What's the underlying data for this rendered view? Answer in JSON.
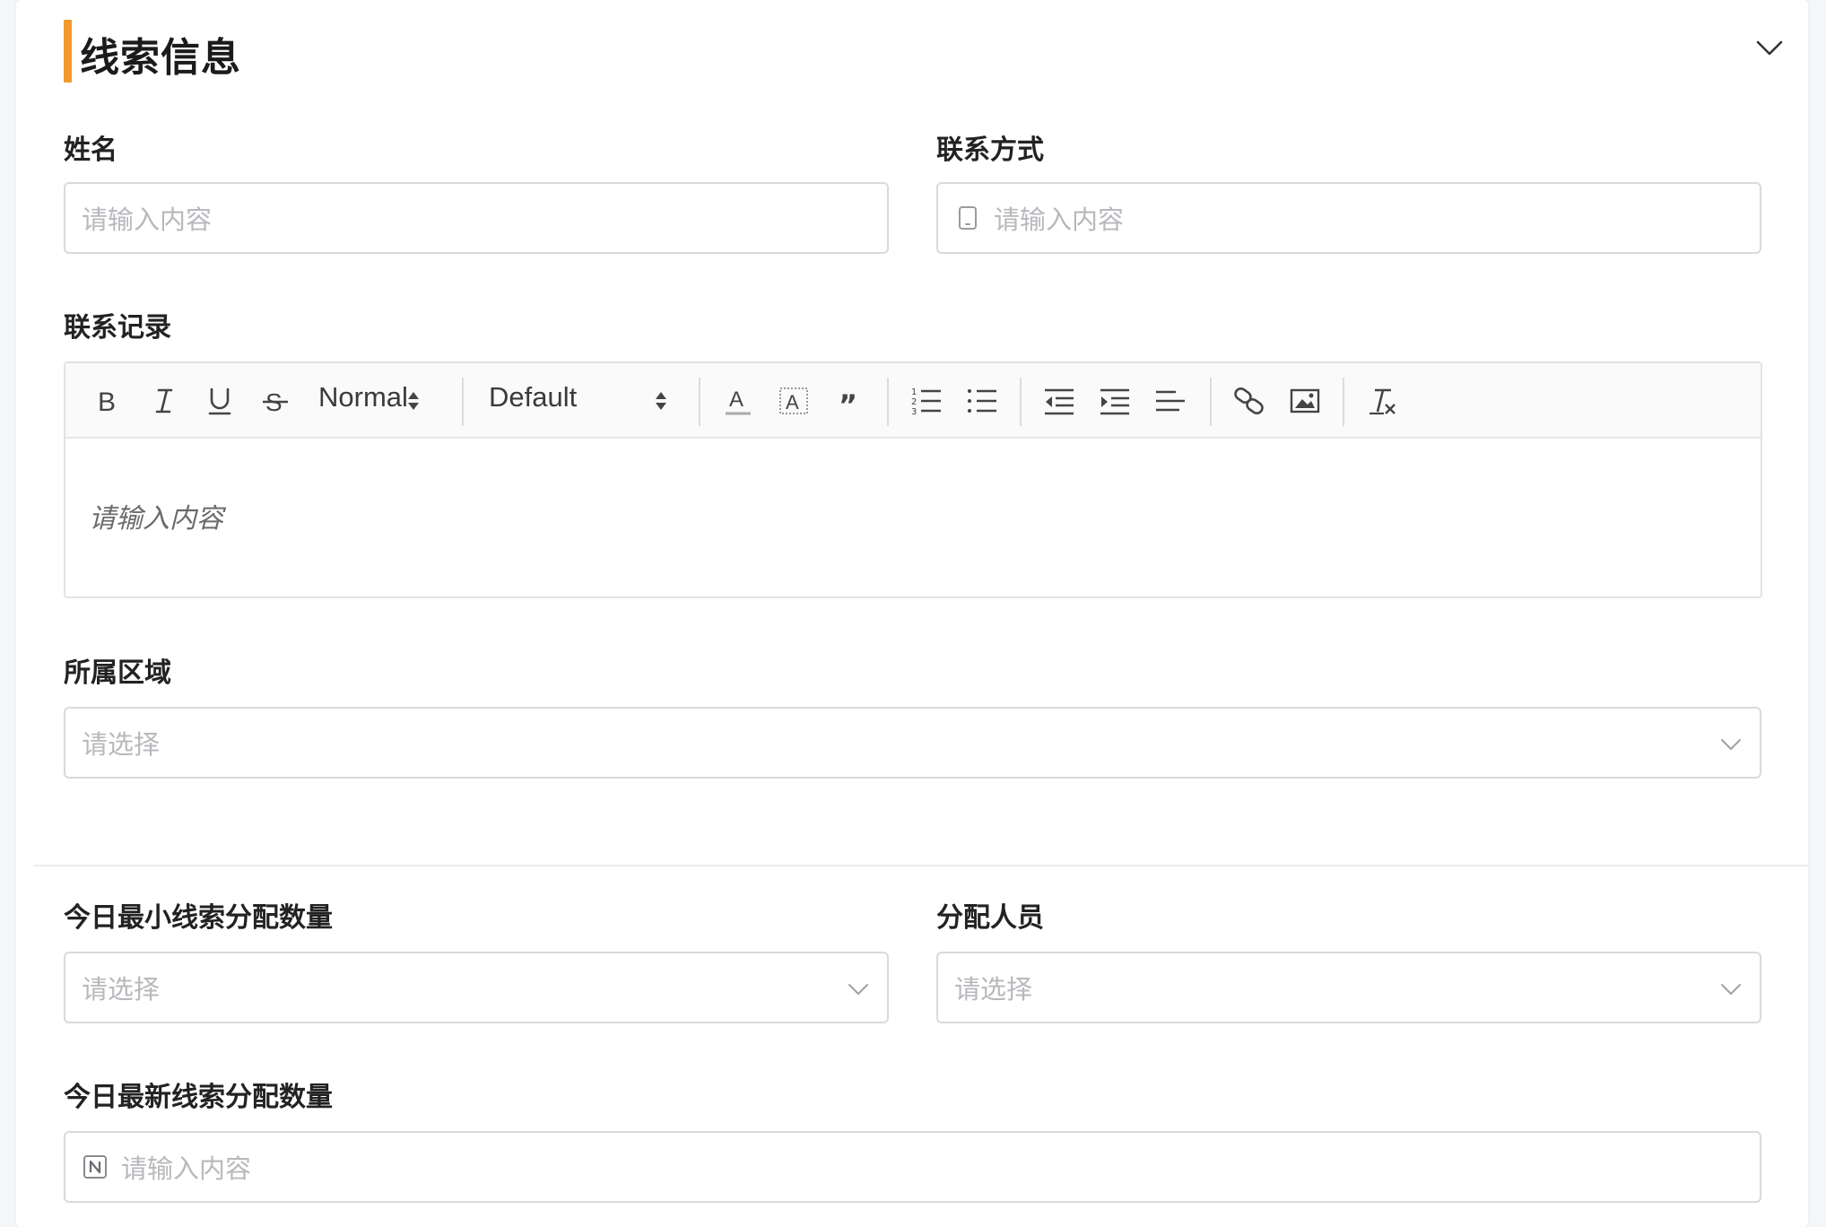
{
  "section": {
    "title": "线索信息"
  },
  "fields": {
    "name": {
      "label": "姓名",
      "placeholder": "请输入内容"
    },
    "contact": {
      "label": "联系方式",
      "placeholder": "请输入内容"
    },
    "record": {
      "label": "联系记录",
      "placeholder": "请输入内容"
    },
    "region": {
      "label": "所属区域",
      "placeholder": "请选择"
    },
    "min_count": {
      "label": "今日最小线索分配数量",
      "placeholder": "请选择"
    },
    "assignee": {
      "label": "分配人员",
      "placeholder": "请选择"
    },
    "new_count": {
      "label": "今日最新线索分配数量",
      "placeholder": "请输入内容"
    }
  },
  "editor_toolbar": {
    "size_select": "Normal",
    "font_select": "Default",
    "buttons": [
      "bold-icon",
      "italic-icon",
      "underline-icon",
      "strike-icon",
      "font-color-icon",
      "background-color-icon",
      "blockquote-icon",
      "ordered-list-icon",
      "bullet-list-icon",
      "outdent-icon",
      "indent-icon",
      "align-icon",
      "link-icon",
      "image-icon",
      "clear-format-icon"
    ]
  },
  "colors": {
    "accent": "#f29a2e",
    "border": "#d9d9de",
    "placeholder": "#b8b8bd"
  }
}
